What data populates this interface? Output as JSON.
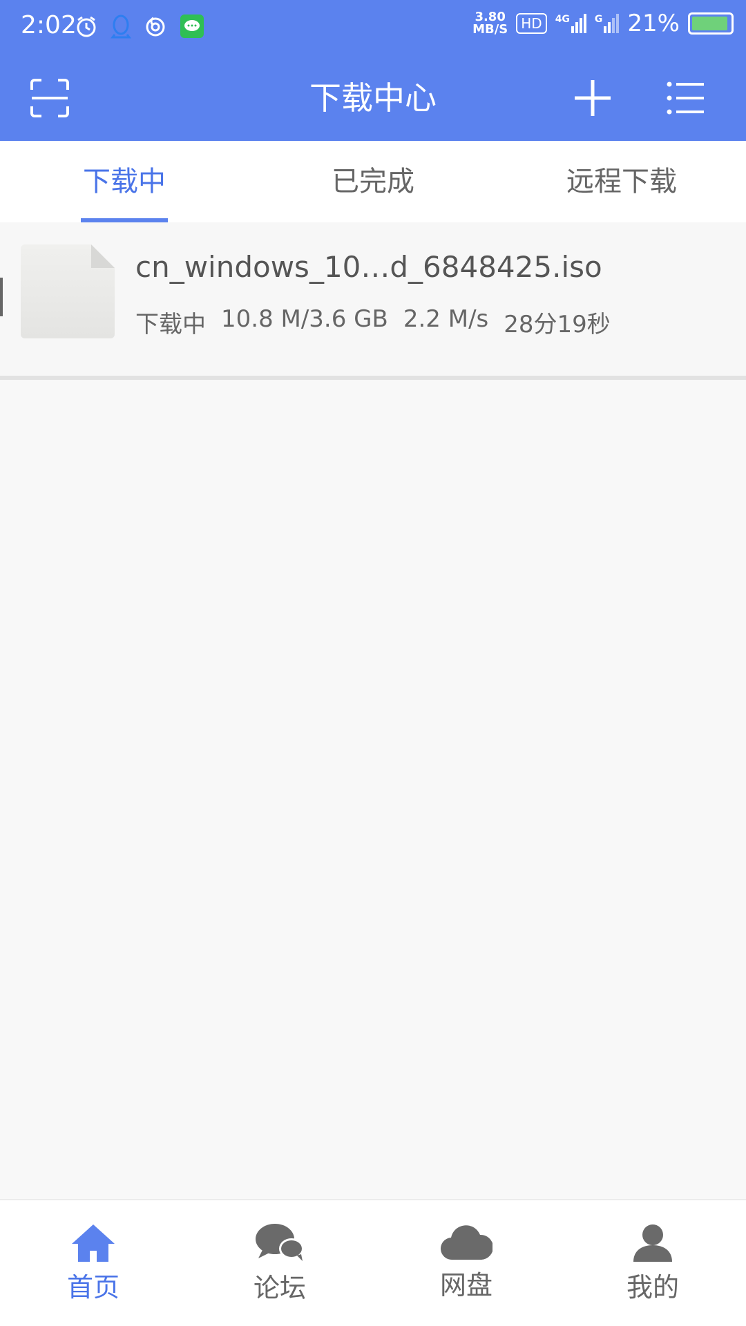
{
  "status_bar": {
    "time": "2:02",
    "net_speed_value": "3.80",
    "net_speed_unit": "MB/S",
    "hd_label": "HD",
    "signal_label_1": "4G",
    "signal_label_2": "G",
    "battery_percent": "21%",
    "battery_level": 0.21,
    "icons": [
      "alarm-icon",
      "qq-icon",
      "netease-icon",
      "message-icon"
    ]
  },
  "toolbar": {
    "title": "下载中心",
    "scan_icon": "scan-icon",
    "add_icon": "plus-icon",
    "menu_icon": "list-menu-icon"
  },
  "tabs": [
    {
      "label": "下载中",
      "active": true
    },
    {
      "label": "已完成",
      "active": false
    },
    {
      "label": "远程下载",
      "active": false
    }
  ],
  "downloads": [
    {
      "name": "cn_windows_10…d_6848425.iso",
      "status": "下载中",
      "progress": "10.8 M/3.6 GB",
      "speed": "2.2 M/s",
      "remaining": "28分19秒",
      "icon": "file-icon"
    }
  ],
  "bottom_nav": [
    {
      "label": "首页",
      "icon": "home-icon",
      "active": true
    },
    {
      "label": "论坛",
      "icon": "forum-icon",
      "active": false
    },
    {
      "label": "网盘",
      "icon": "cloud-icon",
      "active": false
    },
    {
      "label": "我的",
      "icon": "user-icon",
      "active": false
    }
  ],
  "colors": {
    "accent": "#5b82ee",
    "active_text": "#4a74e8",
    "inactive_text": "#666666",
    "background": "#f8f8f8"
  }
}
